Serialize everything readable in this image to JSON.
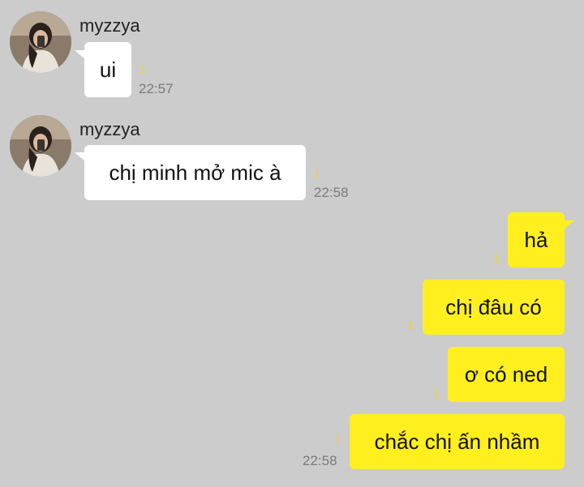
{
  "colors": {
    "background": "#cccccc",
    "incoming_bubble": "#ffffff",
    "outgoing_bubble": "#ffef1f",
    "unread_count": "#e8d43a",
    "timestamp": "#7a7a7a"
  },
  "messages": [
    {
      "direction": "incoming",
      "sender": "myzzya",
      "avatar_icon": "profile-photo-avatar",
      "text": "ui",
      "unread": "1",
      "time": "22:57"
    },
    {
      "direction": "incoming",
      "sender": "myzzya",
      "avatar_icon": "profile-photo-avatar",
      "text": "chị minh mở mic à",
      "unread": "1",
      "time": "22:58"
    },
    {
      "direction": "outgoing",
      "text": "hả",
      "unread": "1"
    },
    {
      "direction": "outgoing",
      "text": "chị đâu có",
      "unread": "1"
    },
    {
      "direction": "outgoing",
      "text": "ơ có ned",
      "unread": "1"
    },
    {
      "direction": "outgoing",
      "text": "chắc chị ấn nhầm",
      "unread": "1",
      "time": "22:58"
    }
  ]
}
